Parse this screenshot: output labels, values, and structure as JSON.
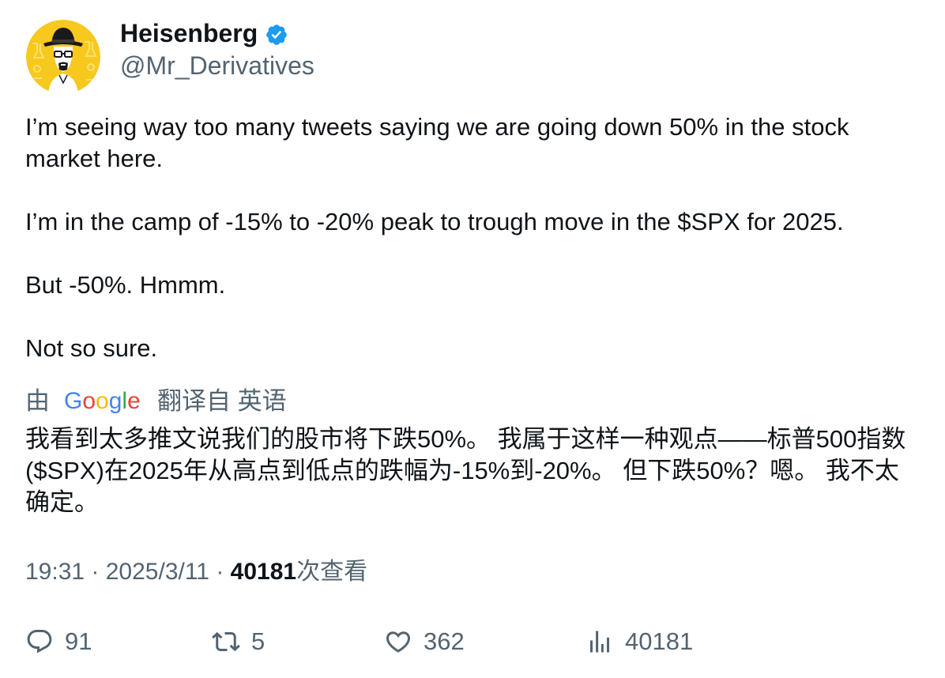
{
  "author": {
    "display_name": "Heisenberg",
    "handle": "@Mr_Derivatives",
    "verified_color": "#1d9bf0",
    "avatar_bg": "#f7c81e"
  },
  "tweet": {
    "paragraphs": [
      "I’m seeing way too many tweets saying we are going down 50% in the stock market here.",
      "I’m in the camp of -15% to -20% peak to trough move in the $SPX for 2025.",
      "But -50%. Hmmm.",
      "Not so sure."
    ]
  },
  "translation": {
    "prefix": "由",
    "provider": "Google",
    "suffix": "翻译自 英语",
    "text": "我看到太多推文说我们的股市将下跌50%。 我属于这样一种观点——标普500指数($SPX)在2025年从高点到低点的跌幅为-15%到-20%。 但下跌50%？嗯。 我不太确定。"
  },
  "meta": {
    "time": "19:31",
    "separator": " · ",
    "date": "2025/3/11",
    "views_count": "40181",
    "views_label": "次查看"
  },
  "actions": {
    "replies": "91",
    "retweets": "5",
    "likes": "362",
    "views": "40181"
  },
  "colors": {
    "text_primary": "#0f1419",
    "text_secondary": "#536471",
    "google_blue": "#4285f4",
    "google_red": "#ea4335",
    "google_yellow": "#fbbc05",
    "google_green": "#34a853"
  },
  "icons": {
    "reply": "speech-bubble-icon",
    "retweet": "retweet-arrows-icon",
    "like": "heart-icon",
    "views": "bar-chart-icon",
    "verified": "verified-badge-icon"
  }
}
